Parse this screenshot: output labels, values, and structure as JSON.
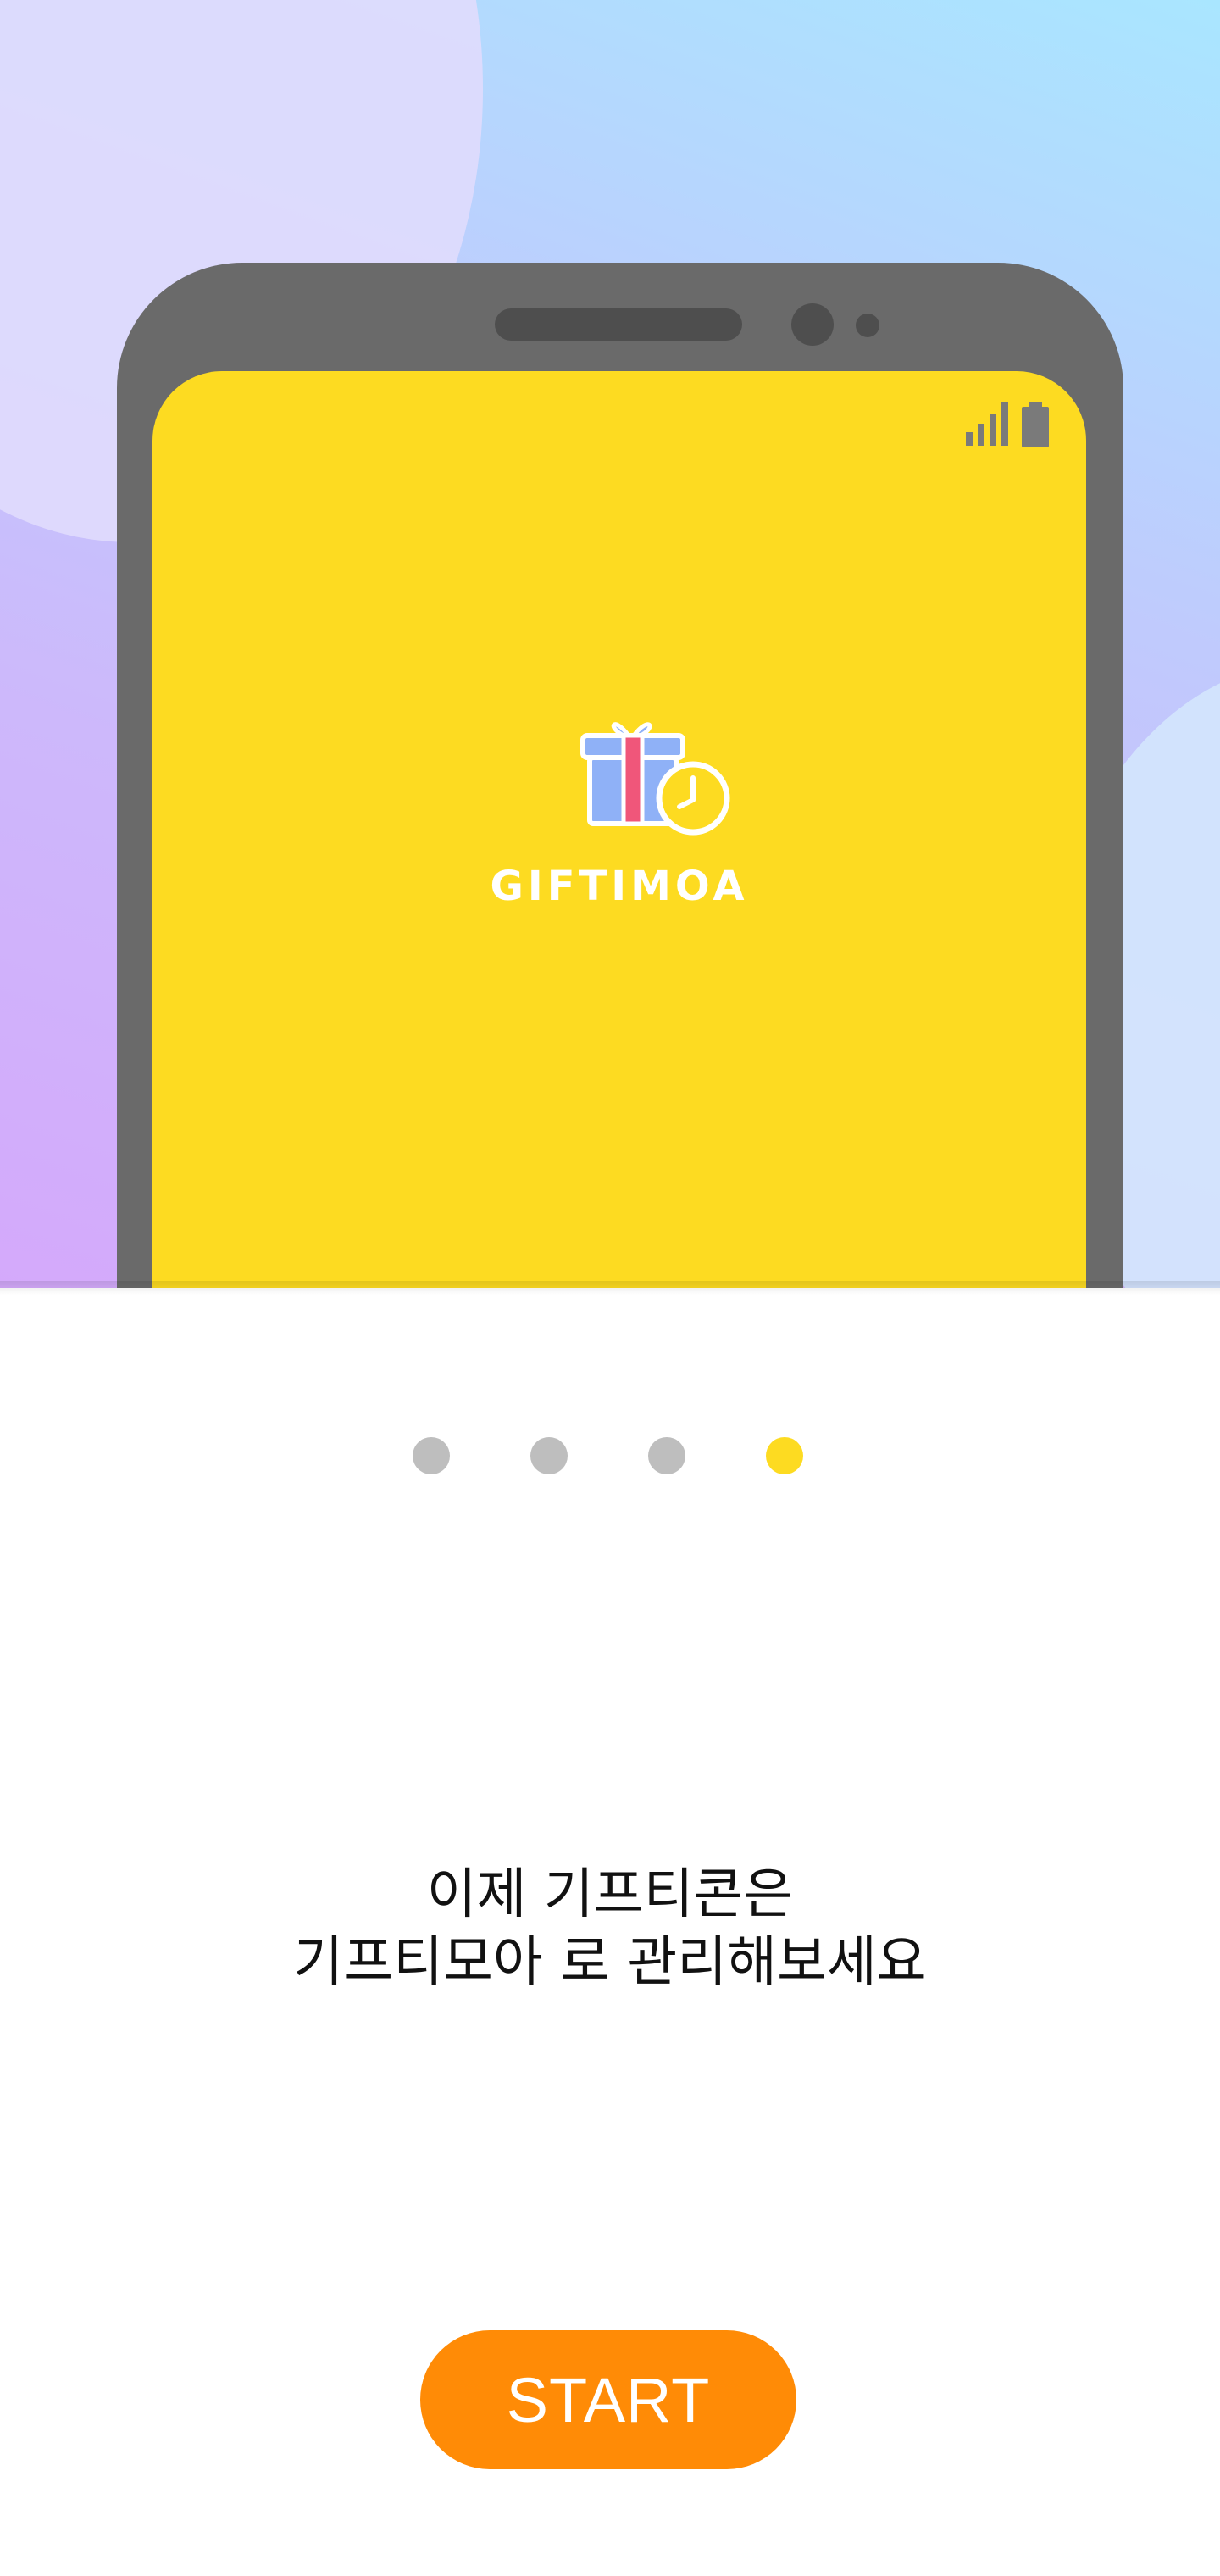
{
  "colors": {
    "screen_yellow": "#fddb21",
    "phone_body": "#6a6a6a",
    "dot_inactive": "#bebebe",
    "dot_active": "#fddb21",
    "button_orange": "#ff8b06",
    "button_text": "#ffffff"
  },
  "hero": {
    "app_name": "GIFTIMOA",
    "logo_icon": "gift-box-with-clock-icon",
    "status_icons": [
      "signal-bars-icon",
      "battery-icon"
    ]
  },
  "pager": {
    "page_count": 4,
    "current_page": 4
  },
  "message": {
    "line1": "이제 기프티콘은",
    "line2": "기프티모아 로 관리해보세요"
  },
  "start_button": {
    "label": "START"
  }
}
